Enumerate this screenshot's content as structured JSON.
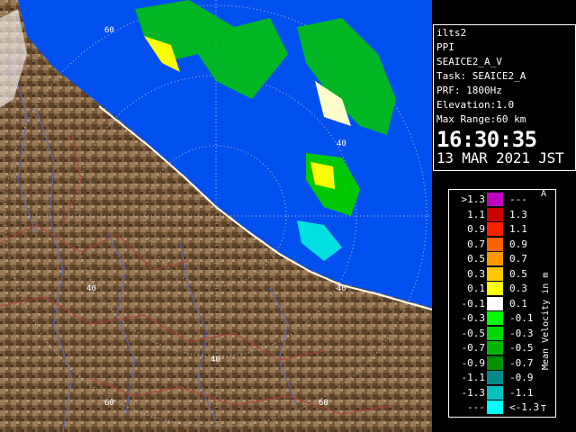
{
  "info": {
    "lines": [
      "ilts2",
      "PPI",
      "SEAICE2_A_V",
      "Task: SEAICE2_A",
      "PRF: 1800Hz",
      "Elevation:1.0",
      "Max Range:60 km"
    ],
    "time": "16:30:35",
    "date": "13 MAR 2021 JST"
  },
  "legend": {
    "axis_label": "Mean Velocity in m/s",
    "top_mark": "A",
    "bottom_mark": "T",
    "rows": [
      {
        "left": ">1.3",
        "right": "---",
        "color": "#c000c0"
      },
      {
        "left": "1.1",
        "right": "1.3",
        "color": "#c80000"
      },
      {
        "left": "0.9",
        "right": "1.1",
        "color": "#ff2000"
      },
      {
        "left": "0.7",
        "right": "0.9",
        "color": "#ff6000"
      },
      {
        "left": "0.5",
        "right": "0.7",
        "color": "#ff9800"
      },
      {
        "left": "0.3",
        "right": "0.5",
        "color": "#ffc800"
      },
      {
        "left": "0.1",
        "right": "0.3",
        "color": "#ffff00"
      },
      {
        "left": "-0.1",
        "right": "0.1",
        "color": "#ffffff"
      },
      {
        "left": "-0.3",
        "right": "-0.1",
        "color": "#00ff00"
      },
      {
        "left": "-0.5",
        "right": "-0.3",
        "color": "#00d800"
      },
      {
        "left": "-0.7",
        "right": "-0.5",
        "color": "#00b400"
      },
      {
        "left": "-0.9",
        "right": "-0.7",
        "color": "#009000"
      },
      {
        "left": "-1.1",
        "right": "-0.9",
        "color": "#008c8c"
      },
      {
        "left": "-1.3",
        "right": "-1.1",
        "color": "#00c0c0"
      },
      {
        "left": "---",
        "right": "<-1.3",
        "color": "#00ffff"
      }
    ]
  },
  "range_labels": [
    "60",
    "40",
    "40",
    "40",
    "40",
    "60",
    "60"
  ],
  "colors": {
    "sea": "#0050f0",
    "land": "#7a5c3c",
    "rivers": "#5a6cc8",
    "boundaries": "#b43c3c"
  }
}
